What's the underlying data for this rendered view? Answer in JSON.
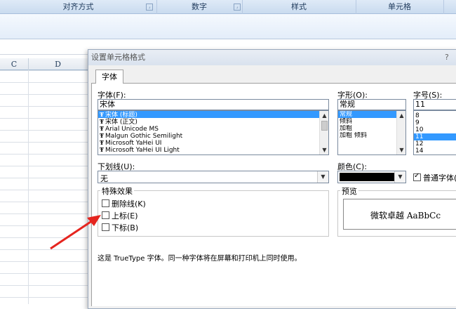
{
  "ribbon": {
    "groups": [
      {
        "label": "对齐方式"
      },
      {
        "label": "数字"
      },
      {
        "label": "样式"
      },
      {
        "label": "单元格"
      }
    ]
  },
  "sheet": {
    "columns": [
      "C",
      "D"
    ]
  },
  "dialog": {
    "title": "设置单元格格式",
    "help": "?",
    "tab": "字体",
    "font_label": "字体(F):",
    "font_value": "宋体",
    "font_list": [
      {
        "label": "宋体 (标题)",
        "selected": true
      },
      {
        "label": "宋体 (正文)",
        "selected": false
      },
      {
        "label": "Arial Unicode MS",
        "selected": false
      },
      {
        "label": "Malgun Gothic Semilight",
        "selected": false
      },
      {
        "label": "Microsoft YaHei UI",
        "selected": false
      },
      {
        "label": "Microsoft YaHei UI Light",
        "selected": false
      }
    ],
    "style_label": "字形(O):",
    "style_value": "常规",
    "style_list": [
      {
        "label": "常规",
        "selected": true
      },
      {
        "label": "倾斜",
        "selected": false
      },
      {
        "label": "加粗",
        "selected": false
      },
      {
        "label": "加粗 倾斜",
        "selected": false
      }
    ],
    "size_label": "字号(S):",
    "size_value": "11",
    "size_list": [
      {
        "label": "8",
        "selected": false
      },
      {
        "label": "9",
        "selected": false
      },
      {
        "label": "10",
        "selected": false
      },
      {
        "label": "11",
        "selected": true
      },
      {
        "label": "12",
        "selected": false
      },
      {
        "label": "14",
        "selected": false
      }
    ],
    "underline_label": "下划线(U):",
    "underline_value": "无",
    "color_label": "颜色(C):",
    "color_swatch": "#000000",
    "normal_font_label": "普通字体(",
    "normal_font_checked": true,
    "effects_title": "特殊效果",
    "effects": [
      {
        "label": "删除线(K)",
        "checked": false
      },
      {
        "label": "上标(E)",
        "checked": false
      },
      {
        "label": "下标(B)",
        "checked": false
      }
    ],
    "preview_title": "预览",
    "preview_text": "微软卓越  AaBbCc",
    "note": "这是 TrueType 字体。同一种字体将在屏幕和打印机上同时使用。"
  },
  "colors": {
    "selection": "#3399ff",
    "annotation_arrow": "#e5251f"
  }
}
